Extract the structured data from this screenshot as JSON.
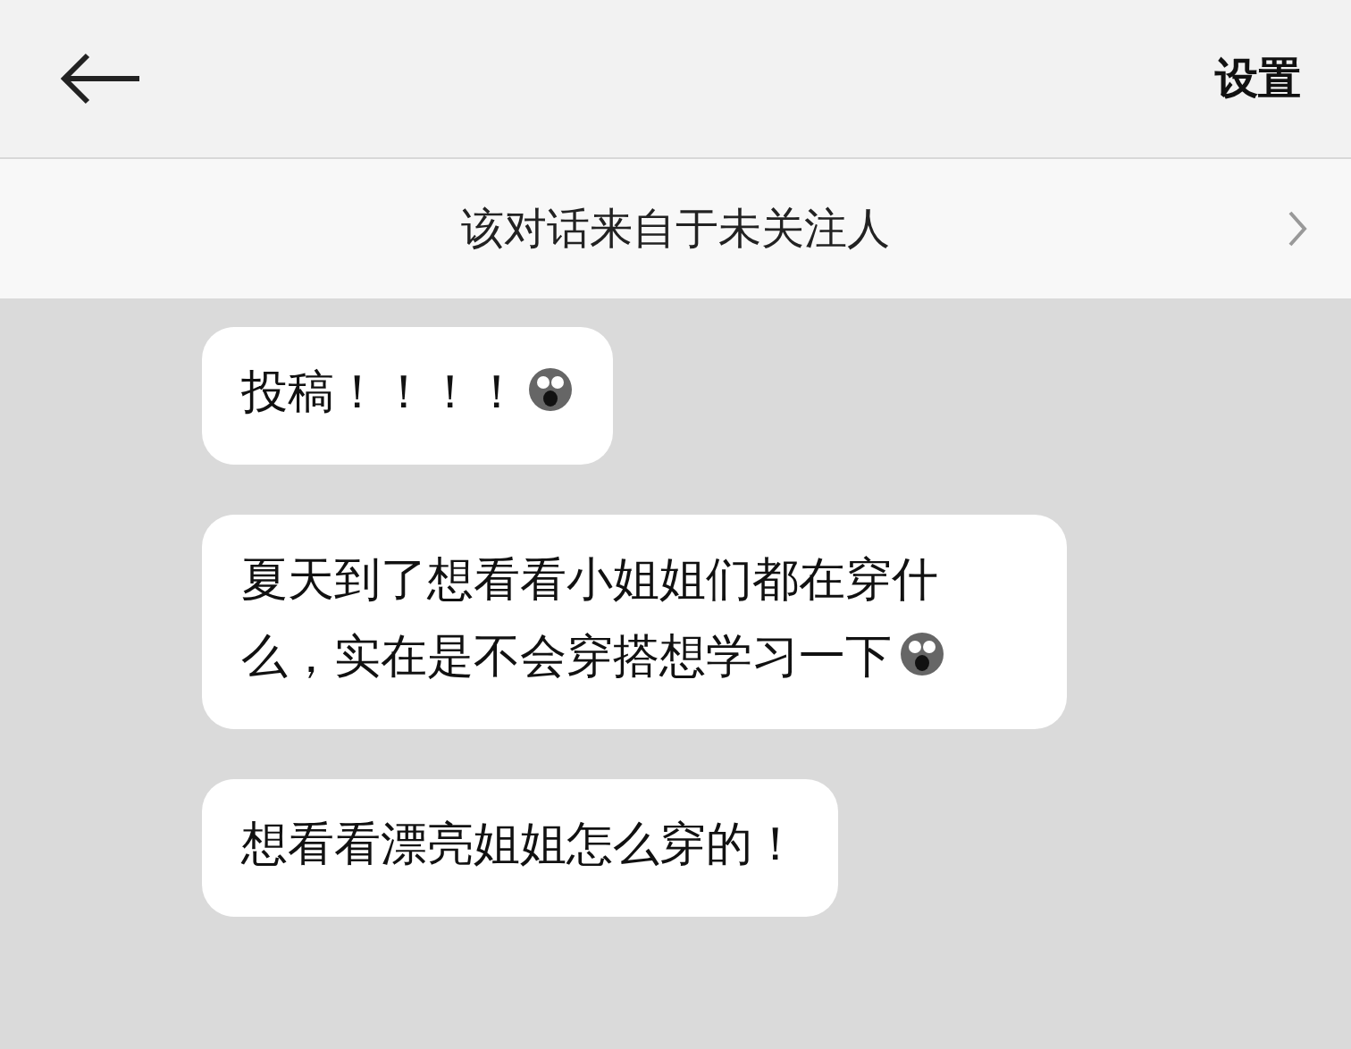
{
  "header": {
    "title": "设置"
  },
  "notice": {
    "text": "该对话来自于未关注人"
  },
  "messages": [
    {
      "text": "投稿！！！！",
      "emoji": true
    },
    {
      "text": "夏天到了想看看小姐姐们都在穿什么，实在是不会穿搭想学习一下",
      "emoji": true
    },
    {
      "text": "想看看漂亮姐姐怎么穿的！",
      "emoji": false
    }
  ]
}
